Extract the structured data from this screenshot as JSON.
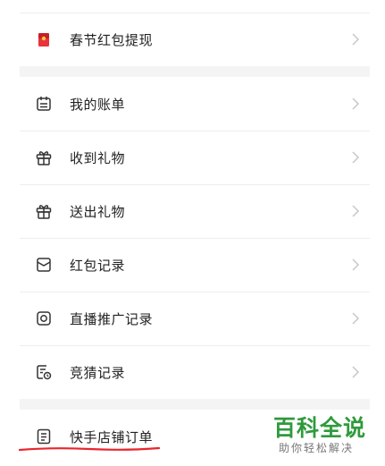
{
  "menu": {
    "items": [
      {
        "label": "春节红包提现",
        "icon": "red-envelope-icon"
      },
      {
        "label": "我的账单",
        "icon": "bill-icon"
      },
      {
        "label": "收到礼物",
        "icon": "gift-icon"
      },
      {
        "label": "送出礼物",
        "icon": "gift-icon"
      },
      {
        "label": "红包记录",
        "icon": "red-packet-record-icon"
      },
      {
        "label": "直播推广记录",
        "icon": "live-promotion-icon"
      },
      {
        "label": "竞猜记录",
        "icon": "quiz-record-icon"
      },
      {
        "label": "快手店铺订单",
        "icon": "document-icon"
      }
    ]
  },
  "watermark": {
    "title": "百科全说",
    "subtitle": "助你轻松解决"
  },
  "colors": {
    "red_envelope": "#e8343a",
    "underline": "#e8262e",
    "watermark_green": "#2f9a3c",
    "section_gap": "#f4f4f4"
  }
}
